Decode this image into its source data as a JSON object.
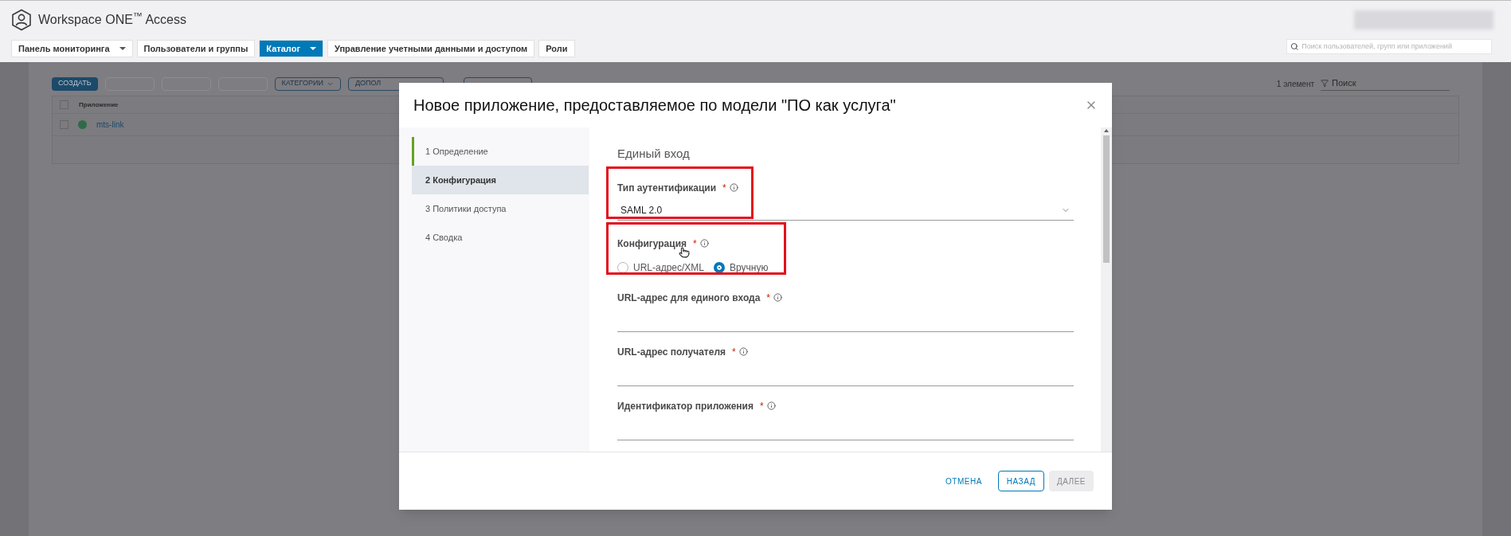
{
  "header": {
    "product": "Workspace ONE$^{™}$ Access",
    "search": {
      "placeholder": "Поиск пользователей, групп или приложений"
    }
  },
  "nav_tabs": [
    {
      "label": "Панель мониторинга",
      "selected": false,
      "dropdown": true
    },
    {
      "label": "Пользователи и группы",
      "selected": false,
      "dropdown": false
    },
    {
      "label": "Каталог",
      "selected": true,
      "dropdown": true
    },
    {
      "label": "Управление учетными данными и доступом",
      "selected": false,
      "dropdown": false
    },
    {
      "label": "Роли",
      "selected": false,
      "dropdown": false
    }
  ],
  "toolbar": [
    {
      "label": "СОЗДАТЬ",
      "kind": "primary"
    },
    {
      "kind": "blurred"
    },
    {
      "kind": "blurred"
    },
    {
      "kind": "blurred"
    },
    {
      "label": "КАТЕГОРИИ",
      "kind": "dropdown"
    },
    {
      "label": "ДОПОЛ",
      "kind": "outline"
    },
    {
      "kind": "blurred-wide"
    }
  ],
  "list": {
    "count": "1 элемент",
    "filter": {
      "placeholder": "Поиск"
    },
    "select_all": {
      "checked": false
    },
    "columns": [
      "Приложение"
    ],
    "rows": [
      {
        "name": "mts-link",
        "checked": false
      }
    ]
  },
  "modal": {
    "title": "Новое приложение, предоставляемое по модели \"ПО как услуга\"",
    "steps": [
      {
        "label": "1 Определение",
        "selected": false,
        "completed": true
      },
      {
        "label": "2 Конфигурация",
        "selected": true,
        "completed": false
      },
      {
        "label": "3 Политики доступа",
        "selected": false,
        "completed": false
      },
      {
        "label": "4 Сводка",
        "selected": false,
        "completed": false
      }
    ],
    "section_title": "Единый вход",
    "fields": [
      {
        "kind": "select",
        "label": "Тип аутентификации",
        "required_mark": "*",
        "value": "SAML 2.0",
        "highlighted": true
      },
      {
        "kind": "radio",
        "label": "Конфигурация",
        "required_mark": "*",
        "highlighted": true,
        "options": [
          {
            "label": "URL-адрес/XML",
            "selected": false
          },
          {
            "label": "Вручную",
            "selected": true
          }
        ]
      },
      {
        "kind": "text",
        "label": "URL-адрес для единого входа",
        "required_mark": "*"
      },
      {
        "kind": "text",
        "label": "URL-адрес получателя",
        "required_mark": "*"
      },
      {
        "kind": "text",
        "label": "Идентификатор приложения",
        "required_mark": "*"
      }
    ],
    "buttons": [
      {
        "label": "ОТМЕНА",
        "kind": "link"
      },
      {
        "label": "НАЗАД",
        "kind": "outline"
      },
      {
        "label": "ДАЛЕЕ",
        "kind": "disabled"
      }
    ]
  }
}
